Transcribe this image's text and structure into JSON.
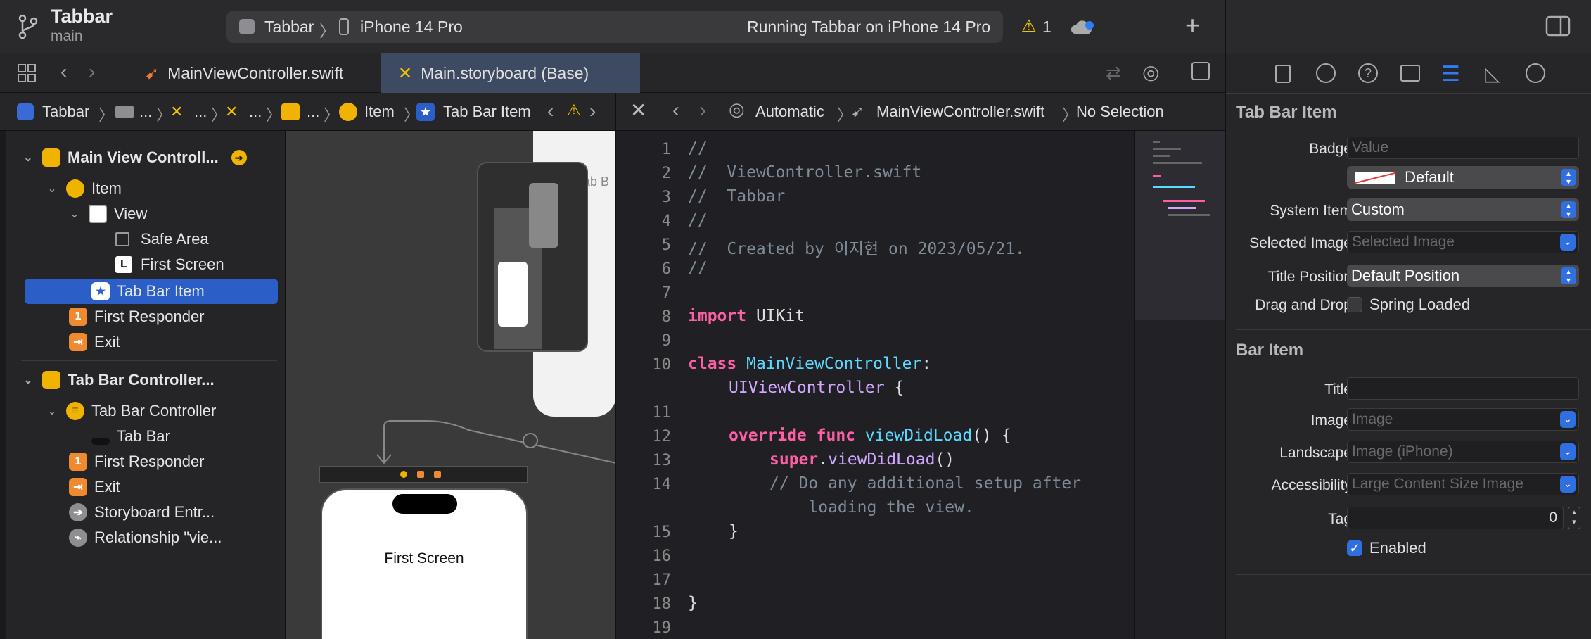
{
  "project": {
    "name": "Tabbar",
    "branch": "main"
  },
  "activity": {
    "scheme": "Tabbar",
    "device": "iPhone 14 Pro",
    "status": "Running Tabbar on iPhone 14 Pro",
    "warnings": "1"
  },
  "tabs": [
    {
      "label": "MainViewController.swift"
    },
    {
      "label": "Main.storyboard (Base)"
    }
  ],
  "jumpbar": {
    "items": [
      "Tabbar",
      "...",
      "...",
      "...",
      "...",
      "Item",
      "Tab Bar Item"
    ],
    "editor_items": [
      "Automatic",
      "MainViewController.swift",
      "No Selection"
    ]
  },
  "navigator": {
    "scene1": "Main View Controll...",
    "item": "Item",
    "view": "View",
    "safe_area": "Safe Area",
    "first_screen": "First Screen",
    "tab_bar_item": "Tab Bar Item",
    "first_responder": "First Responder",
    "exit": "Exit",
    "scene2": "Tab Bar Controller...",
    "tab_bar_controller": "Tab Bar Controller",
    "tab_bar": "Tab Bar",
    "first_responder2": "First Responder",
    "exit2": "Exit",
    "storyboard_entry": "Storyboard Entr...",
    "relationship": "Relationship \"vie..."
  },
  "canvas": {
    "screen_label": "First Screen",
    "tab_label": "Tab B"
  },
  "code": {
    "line_numbers": [
      "1",
      "2",
      "3",
      "4",
      "5",
      "6",
      "7",
      "8",
      "9",
      "10",
      "11",
      "12",
      "13",
      "14",
      "15",
      "16",
      "17",
      "18",
      "19"
    ],
    "l1": "//",
    "l2": "//  ViewController.swift",
    "l3": "//  Tabbar",
    "l4": "//",
    "l5": "//  Created by 이지현 on 2023/05/21.",
    "l6": "//",
    "import_kw": "import",
    "import_mod": " UIKit",
    "class_kw": "class",
    "class_name": " MainViewController",
    "colon": ":",
    "superclass": "UIViewController",
    "brace_open": " {",
    "override_kw": "override",
    "func_kw": " func",
    "method": " viewDidLoad",
    "parens": "() {",
    "super_kw": "super",
    "dot": ".",
    "super_call": "viewDidLoad",
    "call_parens": "()",
    "comment1": "// Do any additional setup after",
    "comment2": "    loading the view.",
    "close1": "}",
    "close2": "}"
  },
  "inspector": {
    "section1": "Tab Bar Item",
    "badge_label": "Badge",
    "badge_placeholder": "Value",
    "badge_color": "Default",
    "system_item_label": "System Item",
    "system_item": "Custom",
    "selected_image_label": "Selected Image",
    "selected_image": "Selected Image",
    "title_position_label": "Title Position",
    "title_position": "Default Position",
    "drag_drop_label": "Drag and Drop",
    "spring_loaded": "Spring Loaded",
    "section2": "Bar Item",
    "title_label": "Title",
    "image_label": "Image",
    "image": "Image",
    "landscape_label": "Landscape",
    "landscape": "Image (iPhone)",
    "accessibility_label": "Accessibility",
    "accessibility": "Large Content Size Image",
    "tag_label": "Tag",
    "tag_value": "0",
    "enabled": "Enabled"
  },
  "colors": {
    "accent": "#2b5ec7",
    "warning": "#f5c400",
    "kw": "#fc5fa3",
    "type": "#5dd8ff"
  }
}
